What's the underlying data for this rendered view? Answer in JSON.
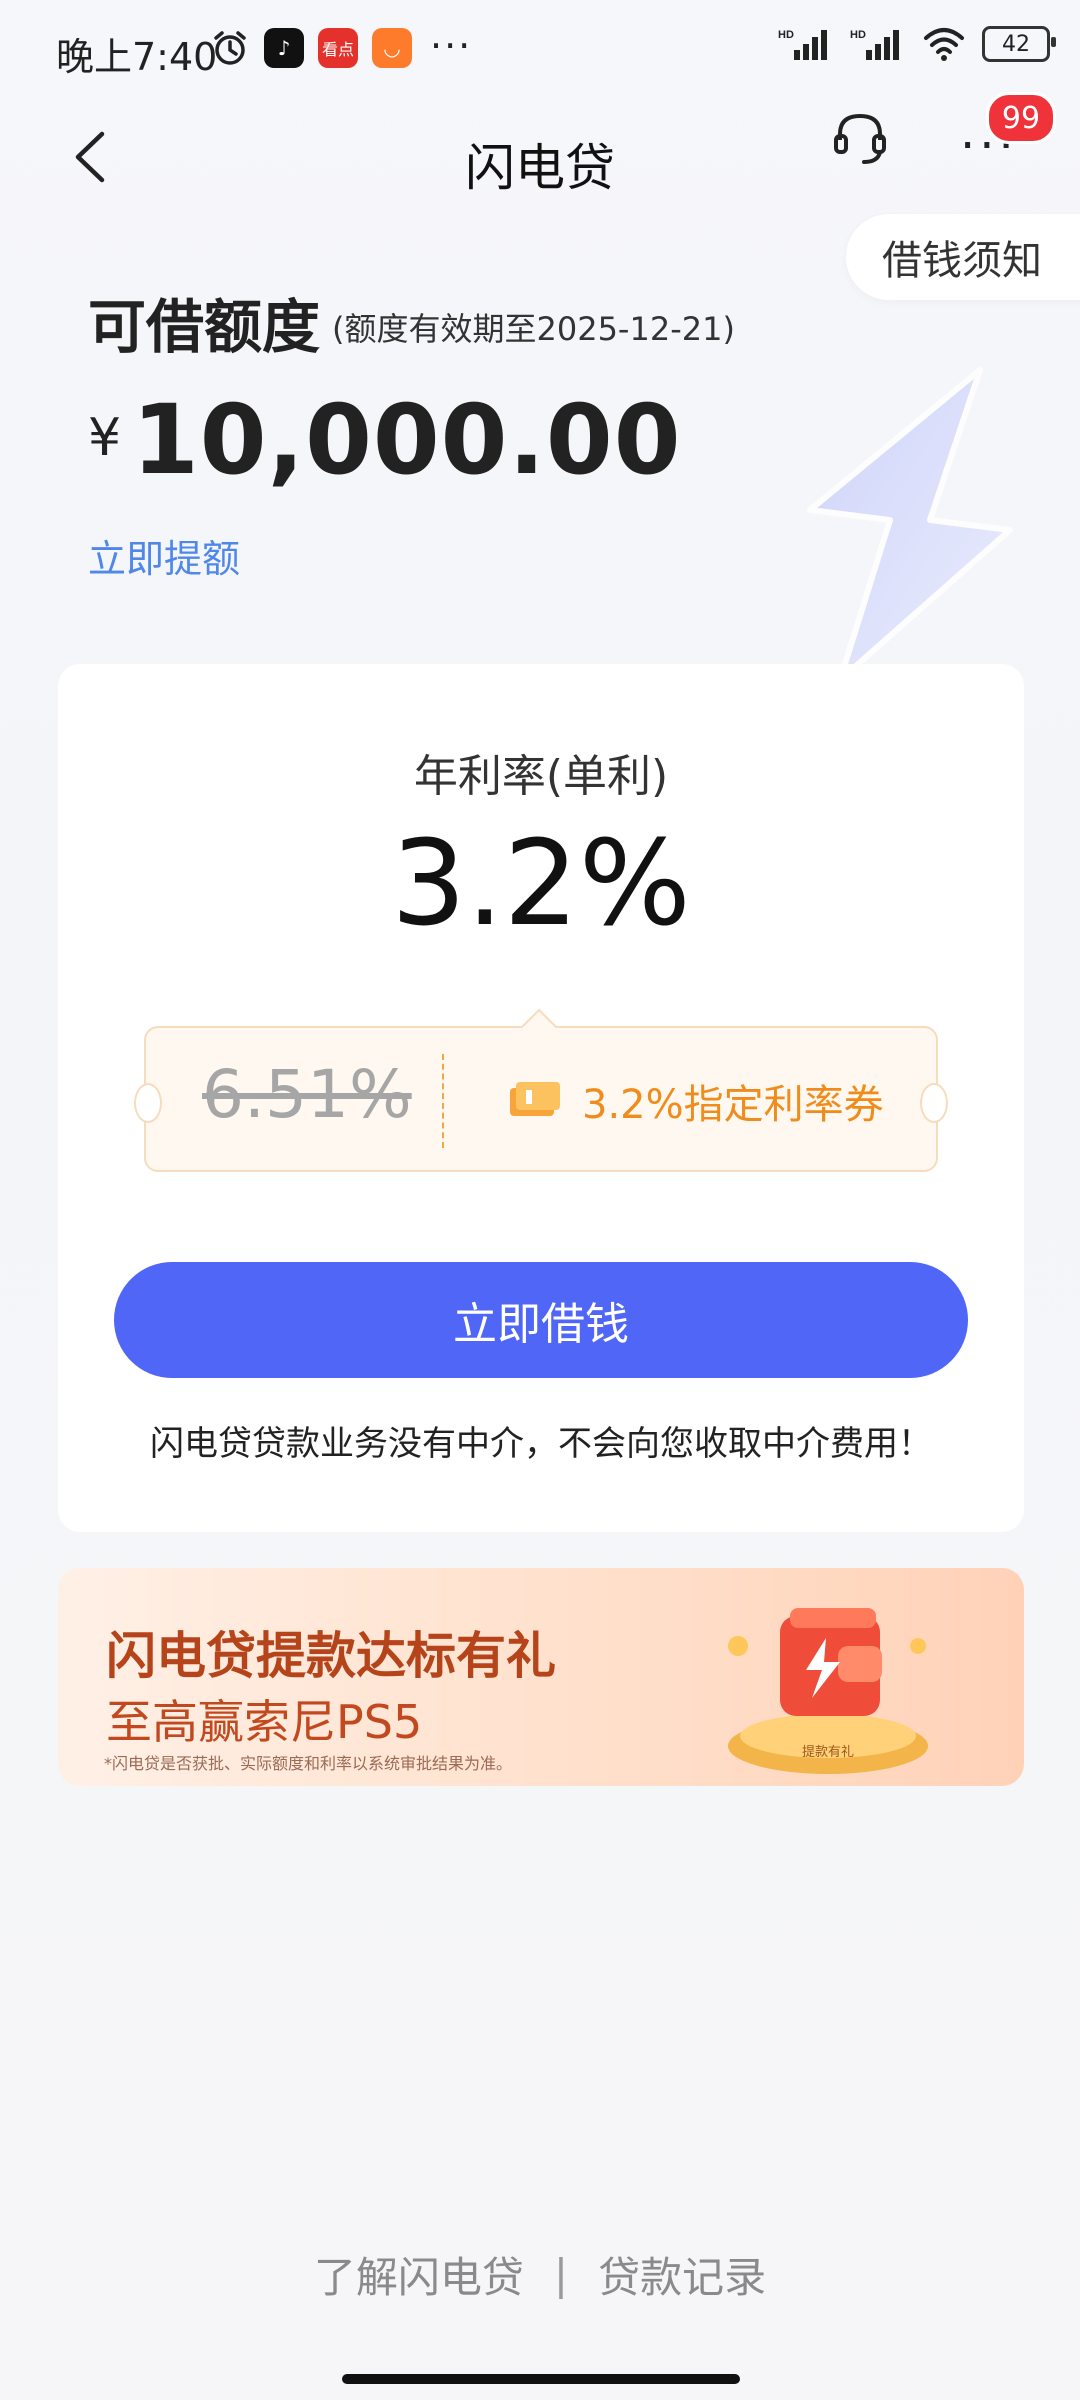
{
  "status_bar": {
    "time": "晚上7:40",
    "app_icons": [
      "alarm-icon",
      "tiktok-icon",
      "kandian-icon",
      "shop-icon"
    ],
    "more": "···",
    "battery": "42"
  },
  "nav": {
    "title": "闪电贷",
    "badge": "99"
  },
  "notice_tag": "借钱须知",
  "limit": {
    "title": "可借额度",
    "validity": "(额度有效期至2025-12-21)",
    "currency": "¥",
    "amount": "10,000.00",
    "raise_link": "立即提额"
  },
  "rate_card": {
    "label": "年利率(单利)",
    "value": "3.2%",
    "old_rate": "6.51%",
    "coupon_text": "3.2%指定利率券",
    "borrow_button": "立即借钱",
    "disclaimer": "闪电贷贷款业务没有中介，不会向您收取中介费用！"
  },
  "banner": {
    "title": "闪电贷提款达标有礼",
    "subtitle": "至高赢索尼PS5",
    "note": "*闪电贷是否获批、实际额度和利率以系统审批结果为准。",
    "gift_label": "提款有礼"
  },
  "footer": {
    "link1": "了解闪电贷",
    "separator": "|",
    "link2": "贷款记录"
  },
  "colors": {
    "primary_button": "#4f66f6",
    "coupon_accent": "#f08c1b",
    "link": "#4f88e8",
    "badge": "#f0333a",
    "banner_title": "#b6441b"
  }
}
